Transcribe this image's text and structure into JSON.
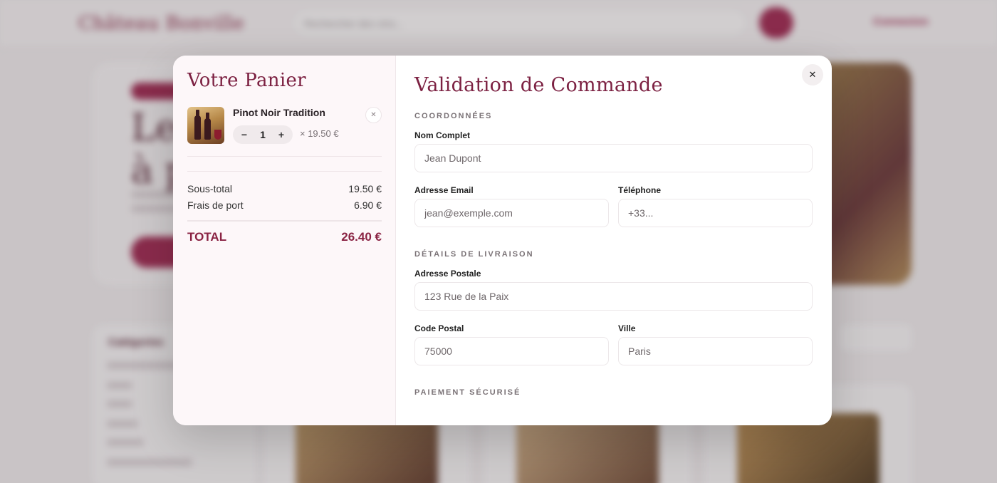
{
  "background": {
    "logo": "Château Bonville",
    "search_placeholder": "Rechercher des vins...",
    "login_label": "Connexion",
    "hero_title_line1": "Les",
    "hero_title_line2": "à p",
    "sidebar_title": "Catégories"
  },
  "cart": {
    "title": "Votre Panier",
    "items": [
      {
        "name": "Pinot Noir Tradition",
        "quantity": "1",
        "unit_price": "× 19.50 €",
        "decrement": "−",
        "increment": "+",
        "remove": "✕"
      }
    ],
    "subtotal_label": "Sous-total",
    "subtotal_value": "19.50 €",
    "shipping_label": "Frais de port",
    "shipping_value": "6.90 €",
    "total_label": "TOTAL",
    "total_value": "26.40 €"
  },
  "checkout": {
    "title": "Validation de Commande",
    "close": "✕",
    "sections": {
      "contact": "COORDONNÉES",
      "delivery": "DÉTAILS DE LIVRAISON",
      "payment": "PAIEMENT SÉCURISÉ"
    },
    "fields": {
      "full_name": {
        "label": "Nom Complet",
        "placeholder": "Jean Dupont"
      },
      "email": {
        "label": "Adresse Email",
        "placeholder": "jean@exemple.com"
      },
      "phone": {
        "label": "Téléphone",
        "placeholder": "+33..."
      },
      "address": {
        "label": "Adresse Postale",
        "placeholder": "123 Rue de la Paix"
      },
      "postal_code": {
        "label": "Code Postal",
        "placeholder": "75000"
      },
      "city": {
        "label": "Ville",
        "placeholder": "Paris"
      }
    }
  },
  "colors": {
    "brand": "#7c2142",
    "accent": "#a02a52",
    "total": "#8a2343"
  }
}
